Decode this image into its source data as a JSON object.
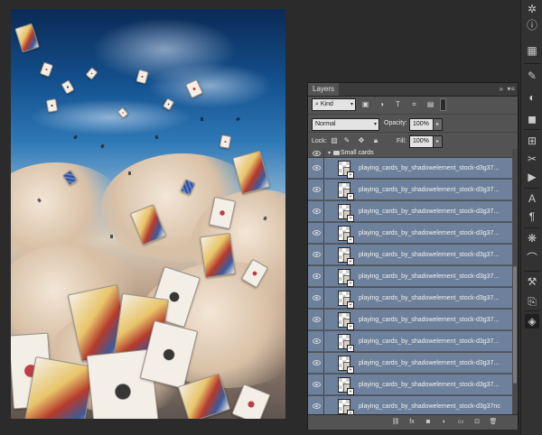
{
  "canvas": {
    "description_alt": ""
  },
  "right_toolbar": {
    "icons": [
      "settings-icon",
      "info-icon",
      "swatches-icon",
      "brush-preset-icon",
      "adjustments-icon",
      "color-icon",
      "styles-icon",
      "tools-icon",
      "play-icon",
      "paragraph-icon",
      "notes-icon",
      "channels-icon",
      "paths-icon",
      "properties-icon",
      "clone-icon",
      "brush-icon",
      "layers-icon"
    ]
  },
  "layers_panel": {
    "tab_label": "Layers",
    "collapse_glyph": "»",
    "menu_glyph": "▾≡",
    "filter": {
      "kind_label": "Kind",
      "search_glyph": "⌕"
    },
    "blend_mode": "Normal",
    "opacity_label": "Opacity:",
    "opacity_value": "100%",
    "lock_label": "Lock:",
    "fill_label": "Fill:",
    "fill_value": "100%",
    "group": {
      "name": "Small cards",
      "expanded": true
    },
    "layers": [
      "playing_cards_by_shadowelement_stock-d3g37...",
      "playing_cards_by_shadowelement_stock-d3g37...",
      "playing_cards_by_shadowelement_stock-d3g37...",
      "playing_cards_by_shadowelement_stock-d3g37...",
      "playing_cards_by_shadowelement_stock-d3g37...",
      "playing_cards_by_shadowelement_stock-d3g37...",
      "playing_cards_by_shadowelement_stock-d3g37...",
      "playing_cards_by_shadowelement_stock-d3g37...",
      "playing_cards_by_shadowelement_stock-d3g37...",
      "playing_cards_by_shadowelement_stock-d3g37...",
      "playing_cards_by_shadowelement_stock-d3g37...",
      "playing_cards_by_shadowelement_stock-d3g37nc"
    ],
    "bottom_icons": [
      "link-icon",
      "fx-icon",
      "mask-icon",
      "adjustment-layer-icon",
      "folder-icon",
      "new-layer-icon",
      "trash-icon"
    ],
    "selection_color": "#6e819c"
  }
}
